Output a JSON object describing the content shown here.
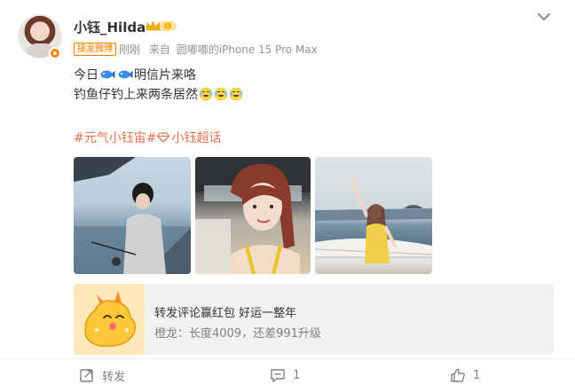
{
  "post": {
    "username": "小钰_Hilda",
    "badge_text": "1",
    "tag": "接龙微博",
    "meta": {
      "time": "刚刚",
      "source_prefix": "来自",
      "source": "圆嘟嘟的iPhone 15 Pro Max"
    },
    "text": {
      "line1_a": "今日",
      "line1_b": "明信片来咯",
      "line2": "钓鱼仔钓上来两条居然"
    },
    "topics": {
      "topic1": "#元气小钰宙#",
      "topic2": "小钰超话"
    },
    "photos": [
      {
        "desc": "photo-1"
      },
      {
        "desc": "photo-2"
      },
      {
        "desc": "photo-3"
      }
    ],
    "promo": {
      "title": "转发评论赢红包 好运一整年",
      "subtitle": "橙龙：长度4009，还差991升级"
    },
    "actions": {
      "repost_label": "转发",
      "comment_count": "1",
      "like_count": "1"
    }
  },
  "colors": {
    "accent_orange": "#ff8200",
    "topic_color": "#eb7350",
    "muted_text": "#939393"
  },
  "icons": [
    "chevron-down-icon",
    "crown-icon",
    "fish-icon",
    "laughing-crying-icon",
    "gem-icon",
    "repost-icon",
    "comment-icon",
    "like-icon"
  ]
}
